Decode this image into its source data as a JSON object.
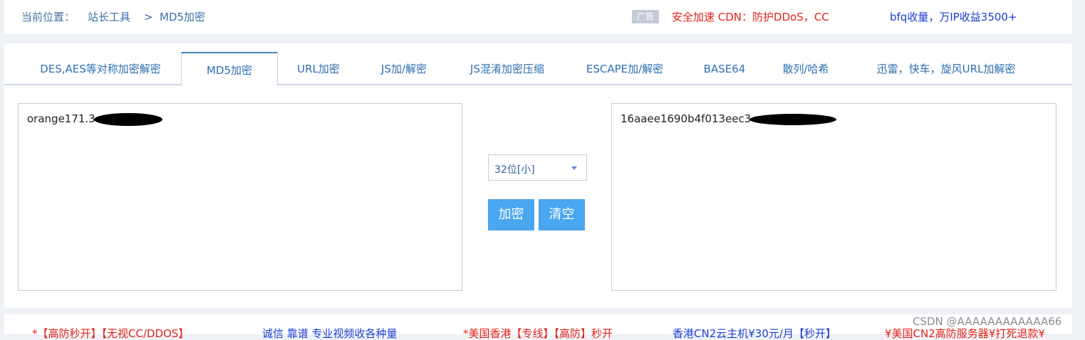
{
  "breadcrumb": {
    "label": "当前位置：",
    "home": "站长工具",
    "separator": ">",
    "current": "MD5加密"
  },
  "ads": {
    "badge": "广告",
    "link1": "安全加速 CDN：防护DDoS，CC",
    "link2": "bfq收量，万IP收益3500+"
  },
  "tabs": [
    {
      "label": "DES,AES等对称加密解密"
    },
    {
      "label": "MD5加密"
    },
    {
      "label": "URL加密"
    },
    {
      "label": "JS加/解密"
    },
    {
      "label": "JS混淆加密压缩"
    },
    {
      "label": "ESCAPE加/解密"
    },
    {
      "label": "BASE64"
    },
    {
      "label": "散列/哈希"
    },
    {
      "label": "迅雷，快车，旋风URL加解密"
    }
  ],
  "active_tab": "MD5加密",
  "input": {
    "value": "orange171.3"
  },
  "output": {
    "value": "16aaee1690b4f013eec3"
  },
  "options": {
    "bits_selected": "32位[小]"
  },
  "buttons": {
    "encrypt": "加密",
    "clear": "清空"
  },
  "bottom_links": [
    "*【高防秒开】【无视CC/DDOS】",
    "诚信 靠谱 专业视频收各种量",
    "*美国香港【专线】【高防】秒开",
    "香港CN2云主机¥30元/月【秒开】",
    "¥美国CN2高防服务器¥打死退款¥"
  ],
  "watermark": "CSDN @AAAAAAAAAAAA66",
  "colors": {
    "accent": "#3d86c6",
    "button": "#4aa6ee",
    "ad_red": "#e2231a",
    "ad_blue": "#1b3fd4"
  }
}
